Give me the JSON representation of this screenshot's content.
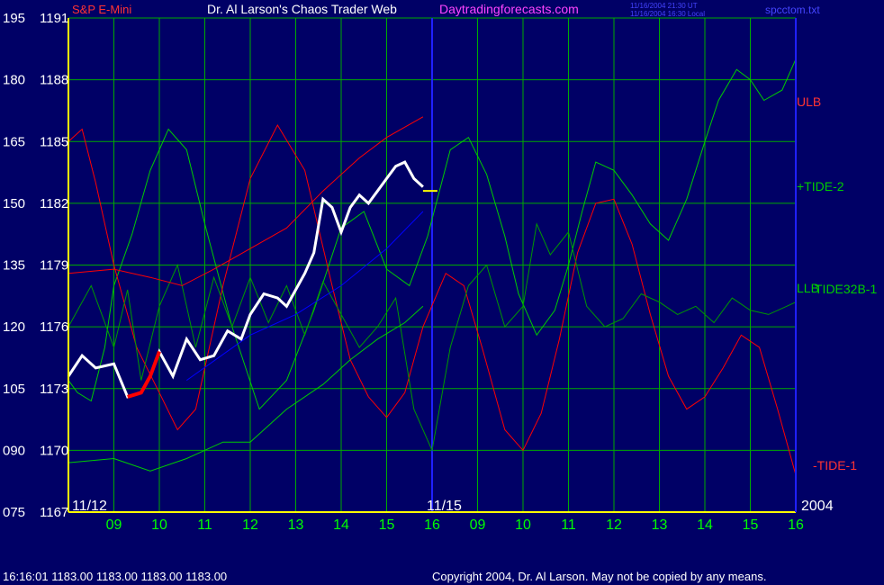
{
  "header": {
    "instrument": "S&P E-Mini",
    "title": "Dr. Al Larson's Chaos Trader Web",
    "site": "Daytradingforecasts.com",
    "stamp_ut": "11/16/2004 21:30 UT",
    "stamp_local": "11/16/2004 16:30 Local",
    "filename": "spcctom.txt"
  },
  "footer": {
    "quote": "16:16:01  1183.00 1183.00 1183.00 1183.00",
    "copyright": "Copyright 2004, Dr. Al Larson. May not be copied by any means."
  },
  "colors": {
    "background": "#000066",
    "grid": "#00aa00",
    "axis": "#ffff00",
    "price_bar": "#ffffff",
    "price_down": "#ff0000",
    "tide2": "#00cc00",
    "tide32": "#009900",
    "tide1": "#ff0000",
    "ulb": "#ff0000",
    "llb": "#00cc00",
    "trend": "#0000ff",
    "session_line": "#2020ff"
  },
  "chart_data": {
    "type": "line",
    "y_axis_left_tide": [
      "195",
      "180",
      "165",
      "150",
      "135",
      "120",
      "105",
      "090",
      "075"
    ],
    "y_axis_left_price": [
      "1191",
      "1188",
      "1185",
      "1182",
      "1179",
      "1176",
      "1173",
      "1170",
      "1167"
    ],
    "ylim_price": [
      1167,
      1191
    ],
    "x_hours_day1": [
      "09",
      "10",
      "11",
      "12",
      "13",
      "14",
      "15",
      "16"
    ],
    "x_hours_day2": [
      "09",
      "10",
      "11",
      "12",
      "13",
      "14",
      "15",
      "16"
    ],
    "date_labels": [
      "11/12",
      "11/15"
    ],
    "year_label": "2004",
    "right_labels": [
      "ULB",
      "+TIDE-2",
      "LLB",
      "TIDE32B-1",
      "-TIDE-1"
    ],
    "grid": true,
    "series": [
      {
        "name": "+TIDE-2",
        "x": [
          0,
          0.2,
          0.5,
          0.8,
          1.0,
          1.4,
          1.8,
          2.2,
          2.6,
          3.0,
          3.6,
          4.2,
          4.8,
          5.4,
          6.0,
          6.5,
          7.0,
          7.5,
          7.9,
          8.4,
          8.8,
          9.2,
          9.6,
          9.9,
          10.3,
          10.7,
          11.0,
          11.3,
          11.6,
          12.0,
          12.4,
          12.8,
          13.2,
          13.6,
          14.0,
          14.3,
          14.7,
          15.0,
          15.3,
          15.7,
          16.0
        ],
        "y": [
          1173.4,
          1172.8,
          1172.4,
          1175.0,
          1178.0,
          1180.5,
          1183.6,
          1185.6,
          1184.6,
          1181.0,
          1176.0,
          1172.0,
          1173.4,
          1176.8,
          1180.8,
          1181.6,
          1178.8,
          1178.0,
          1180.4,
          1184.6,
          1185.2,
          1183.4,
          1180.4,
          1177.6,
          1175.6,
          1176.8,
          1179.0,
          1181.6,
          1184.0,
          1183.6,
          1182.4,
          1181.0,
          1180.2,
          1182.2,
          1185.0,
          1187.0,
          1188.5,
          1188.0,
          1187.0,
          1187.5,
          1189.0
        ]
      },
      {
        "name": "-TIDE-1",
        "x": [
          0,
          0.3,
          0.6,
          1.0,
          1.5,
          2.0,
          2.4,
          2.8,
          3.4,
          4.0,
          4.6,
          5.2,
          5.8,
          6.2,
          6.6,
          7.0,
          7.4,
          7.8,
          8.3,
          8.7,
          9.1,
          9.6,
          10.0,
          10.4,
          10.8,
          11.2,
          11.6,
          12.0,
          12.4,
          12.8,
          13.2,
          13.6,
          14.0,
          14.4,
          14.8,
          15.2,
          15.6,
          16.0
        ],
        "y": [
          1185.0,
          1185.6,
          1183.0,
          1179.0,
          1175.0,
          1172.8,
          1171.0,
          1172.0,
          1178.0,
          1183.2,
          1185.8,
          1183.6,
          1178.0,
          1174.4,
          1172.6,
          1171.6,
          1172.8,
          1176.0,
          1178.6,
          1178.0,
          1175.0,
          1171.0,
          1170.0,
          1171.8,
          1175.4,
          1179.6,
          1182.0,
          1182.2,
          1180.0,
          1176.6,
          1173.6,
          1172.0,
          1172.6,
          1174.0,
          1175.6,
          1175.0,
          1172.0,
          1168.8
        ]
      },
      {
        "name": "TIDE32B-1",
        "x": [
          0,
          0.5,
          1.0,
          1.3,
          1.6,
          2.0,
          2.4,
          2.8,
          3.2,
          3.6,
          4.0,
          4.4,
          4.8,
          5.2,
          5.6,
          6.0,
          6.4,
          6.8,
          7.2,
          7.6,
          8.0,
          8.4,
          8.8,
          9.2,
          9.6,
          10.0,
          10.3,
          10.6,
          11.0,
          11.4,
          11.8,
          12.2,
          12.6,
          13.0,
          13.4,
          13.8,
          14.2,
          14.6,
          15.0,
          15.4,
          15.8,
          16.0
        ],
        "y": [
          1176.0,
          1178.0,
          1175.0,
          1177.8,
          1173.4,
          1177.0,
          1179.0,
          1175.0,
          1178.4,
          1176.0,
          1178.4,
          1176.2,
          1178.0,
          1175.6,
          1178.2,
          1176.6,
          1175.0,
          1176.0,
          1177.4,
          1172.0,
          1170.0,
          1175.0,
          1178.0,
          1179.0,
          1176.0,
          1177.0,
          1181.0,
          1179.5,
          1180.6,
          1177.0,
          1176.0,
          1176.4,
          1177.6,
          1177.2,
          1176.6,
          1177.0,
          1176.2,
          1177.4,
          1176.8,
          1176.6,
          1177.0,
          1177.2
        ]
      },
      {
        "name": "ULB",
        "x": [
          0,
          1.0,
          1.8,
          2.5,
          3.2,
          4.0,
          4.8,
          5.6,
          6.4,
          7.0,
          7.8
        ],
        "y": [
          1178.6,
          1178.8,
          1178.4,
          1178.0,
          1178.8,
          1179.8,
          1180.8,
          1182.6,
          1184.2,
          1185.2,
          1186.2
        ]
      },
      {
        "name": "LLB",
        "x": [
          0,
          1.0,
          1.8,
          2.6,
          3.4,
          4.0,
          4.8,
          5.6,
          6.2,
          6.8,
          7.4,
          7.8
        ],
        "y": [
          1169.4,
          1169.6,
          1169.0,
          1169.6,
          1170.4,
          1170.4,
          1172.0,
          1173.2,
          1174.4,
          1175.4,
          1176.2,
          1177.0
        ]
      },
      {
        "name": "price",
        "x": [
          0,
          0.3,
          0.6,
          1.0,
          1.3,
          1.6,
          1.8,
          2.0,
          2.3,
          2.6,
          2.9,
          3.2,
          3.5,
          3.8,
          4.0,
          4.3,
          4.6,
          4.8,
          5.0,
          5.2,
          5.4,
          5.6,
          5.8,
          6.0,
          6.2,
          6.4,
          6.6,
          6.8,
          7.0,
          7.2,
          7.4,
          7.6,
          7.8
        ],
        "y": [
          1173.6,
          1174.6,
          1174.0,
          1174.2,
          1172.6,
          1172.8,
          1173.6,
          1174.8,
          1173.6,
          1175.4,
          1174.4,
          1174.6,
          1175.8,
          1175.4,
          1176.6,
          1177.6,
          1177.4,
          1177.0,
          1177.8,
          1178.6,
          1179.6,
          1182.2,
          1181.8,
          1180.6,
          1181.8,
          1182.4,
          1182.0,
          1182.6,
          1183.2,
          1183.8,
          1184.0,
          1183.2,
          1182.8
        ]
      },
      {
        "name": "trend",
        "x": [
          2.6,
          4.0,
          5.0,
          6.0,
          7.0,
          7.8
        ],
        "y": [
          1173.4,
          1175.6,
          1176.6,
          1178.0,
          1179.8,
          1181.6
        ]
      }
    ],
    "forecast_marker": {
      "x": 7.8,
      "y": 1182.6
    },
    "annotations": {
      "down_segment_x": [
        1.2,
        2.0
      ]
    }
  }
}
